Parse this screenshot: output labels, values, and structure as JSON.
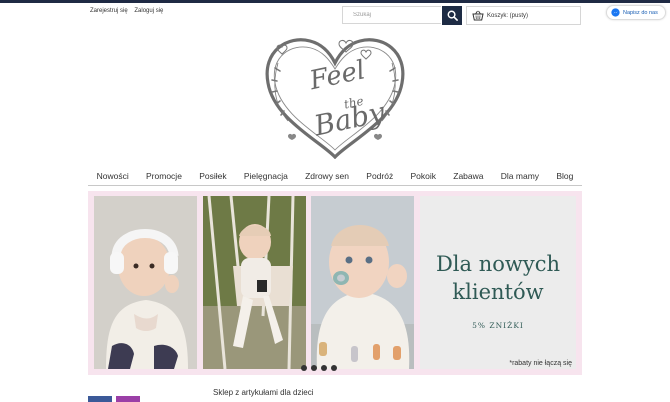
{
  "header": {
    "account_links": [
      "Zarejestruj się",
      "Zaloguj się"
    ],
    "search_placeholder": "Szukaj",
    "cart_label": "Koszyk: (pusty)",
    "messenger_label": "Napisz do nas"
  },
  "logo": {
    "line1": "Feel",
    "line2": "the",
    "line3": "Baby"
  },
  "nav": {
    "items": [
      "Nowości",
      "Promocje",
      "Posiłek",
      "Pielęgnacja",
      "Zdrowy sen",
      "Podróż",
      "Pokoik",
      "Zabawa",
      "Dla mamy",
      "Blog"
    ]
  },
  "banner": {
    "headline_line1": "Dla nowych",
    "headline_line2": "klientów",
    "discount": "5% ZNIŻKI",
    "note": "*rabaty  nie łączą się",
    "slide_count": 4
  },
  "footer": {
    "shop_text": "Sklep z artykułami dla dzieci"
  },
  "colors": {
    "navy": "#1d2b44",
    "banner_bg": "#f7e4ee",
    "headline": "#2f5a55",
    "facebook": "#3b5998",
    "instagram": "#9b3fa7"
  }
}
